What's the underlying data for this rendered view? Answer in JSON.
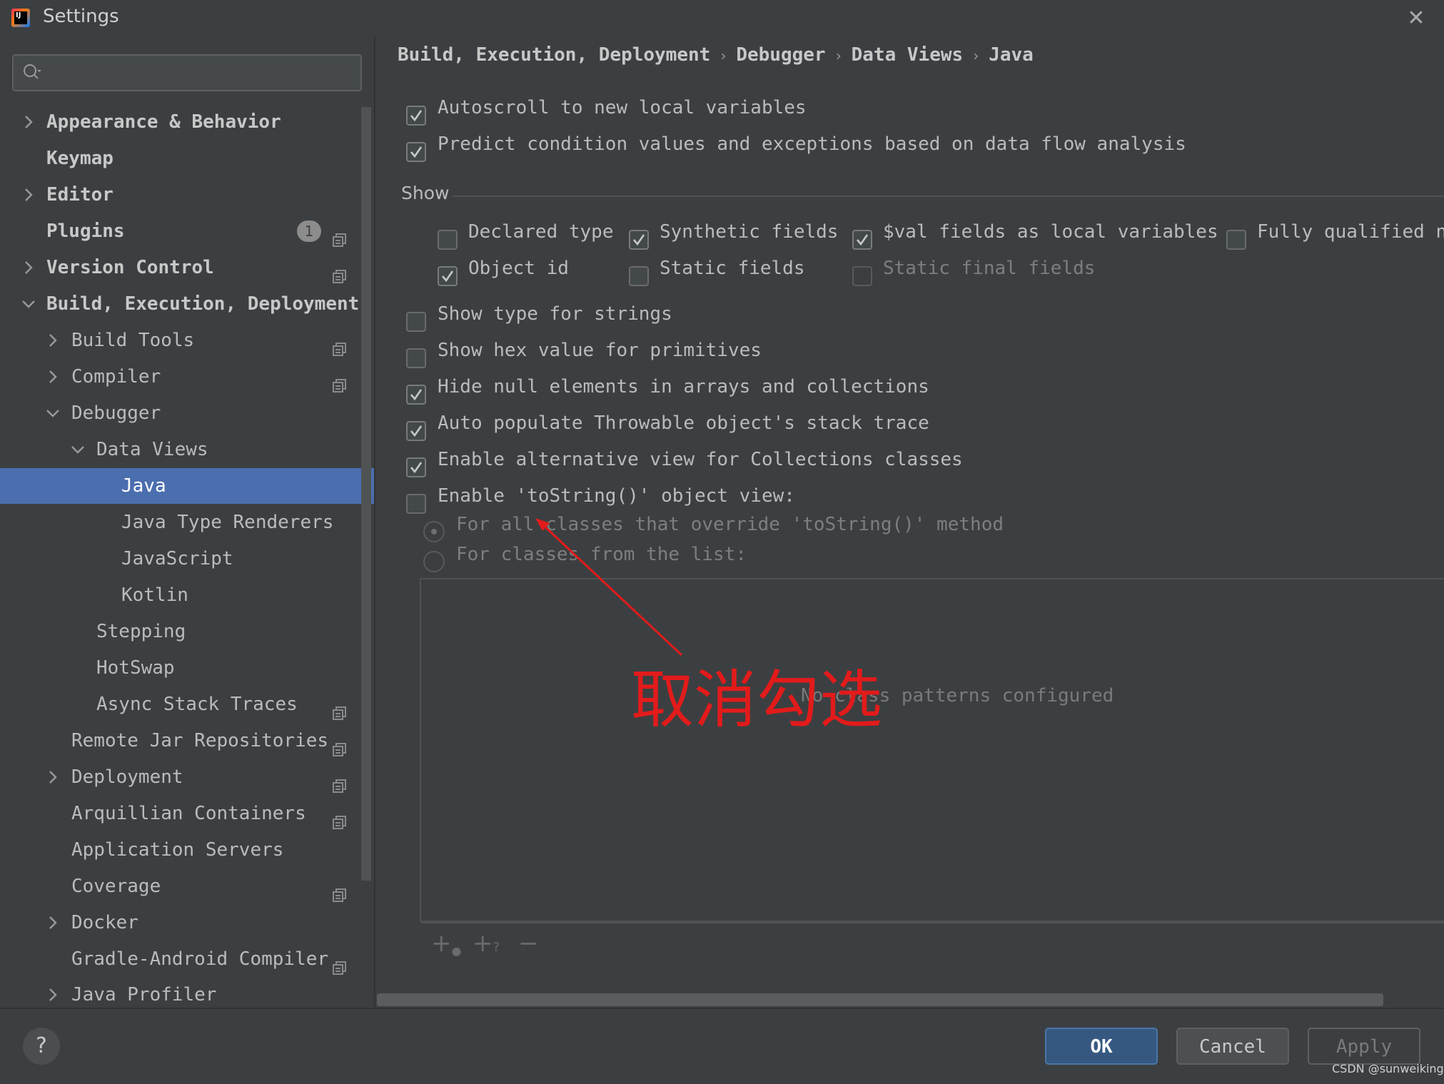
{
  "window": {
    "title": "Settings",
    "close_icon": "close-icon"
  },
  "search": {
    "placeholder": "",
    "value": ""
  },
  "sidebar": {
    "items": [
      {
        "label": "Appearance & Behavior",
        "bold": true,
        "chevron": "right"
      },
      {
        "label": "Keymap",
        "bold": true,
        "chevron": "none"
      },
      {
        "label": "Editor",
        "bold": true,
        "chevron": "right"
      },
      {
        "label": "Plugins",
        "bold": true,
        "chevron": "none",
        "badge": "1"
      },
      {
        "label": "Version Control",
        "bold": true,
        "chevron": "right"
      },
      {
        "label": "Build, Execution, Deployment",
        "bold": true,
        "chevron": "down"
      },
      {
        "label": "Build Tools",
        "chevron": "right"
      },
      {
        "label": "Compiler",
        "chevron": "right"
      },
      {
        "label": "Debugger",
        "chevron": "down"
      },
      {
        "label": "Data Views",
        "chevron": "down"
      },
      {
        "label": "Java",
        "selected": true
      },
      {
        "label": "Java Type Renderers"
      },
      {
        "label": "JavaScript"
      },
      {
        "label": "Kotlin"
      },
      {
        "label": "Stepping"
      },
      {
        "label": "HotSwap"
      },
      {
        "label": "Async Stack Traces"
      },
      {
        "label": "Remote Jar Repositories"
      },
      {
        "label": "Deployment",
        "chevron": "right"
      },
      {
        "label": "Arquillian Containers"
      },
      {
        "label": "Application Servers"
      },
      {
        "label": "Coverage"
      },
      {
        "label": "Docker",
        "chevron": "right"
      },
      {
        "label": "Gradle-Android Compiler"
      },
      {
        "label": "Java Profiler",
        "chevron": "right"
      }
    ]
  },
  "breadcrumb": [
    "Build, Execution, Deployment",
    "Debugger",
    "Data Views",
    "Java"
  ],
  "options_top": [
    {
      "label": "Autoscroll to new local variables",
      "checked": true
    },
    {
      "label": "Predict condition values and exceptions based on data flow analysis",
      "checked": true
    }
  ],
  "show_group": {
    "title": "Show",
    "row1": [
      {
        "label": "Declared type",
        "checked": false
      },
      {
        "label": "Synthetic fields",
        "checked": true
      },
      {
        "label": "$val fields as local variables",
        "checked": true
      },
      {
        "label": "Fully qualified na",
        "checked": false
      }
    ],
    "row2": [
      {
        "label": "Object id",
        "checked": true
      },
      {
        "label": "Static fields",
        "checked": false
      },
      {
        "label": "Static final fields",
        "checked": false,
        "disabled": true
      }
    ]
  },
  "options_bottom": [
    {
      "label": "Show type for strings",
      "checked": false
    },
    {
      "label": "Show hex value for primitives",
      "checked": false
    },
    {
      "label": "Hide null elements in arrays and collections",
      "checked": true
    },
    {
      "label": "Auto populate Throwable object's stack trace",
      "checked": true
    },
    {
      "label": "Enable alternative view for Collections classes",
      "checked": true
    },
    {
      "label": "Enable 'toString()' object view:",
      "checked": false
    }
  ],
  "tostring_radios": [
    {
      "label": "For all classes that override 'toString()' method",
      "selected": true
    },
    {
      "label": "For classes from the list:",
      "selected": false
    }
  ],
  "pattern_list": {
    "empty_text": "No class patterns configured"
  },
  "list_toolbar": {
    "add": "+",
    "add_pattern": "+",
    "add_pattern_sub": "?",
    "remove": "−"
  },
  "annotation": {
    "text": "取消勾选",
    "color": "#e21b1b"
  },
  "footer": {
    "help": "?",
    "ok": "OK",
    "cancel": "Cancel",
    "apply": "Apply"
  },
  "watermark": "CSDN @sunweiking",
  "colors": {
    "selection": "#4b6eaf",
    "background": "#3c3f41",
    "ok_button": "#365880"
  }
}
